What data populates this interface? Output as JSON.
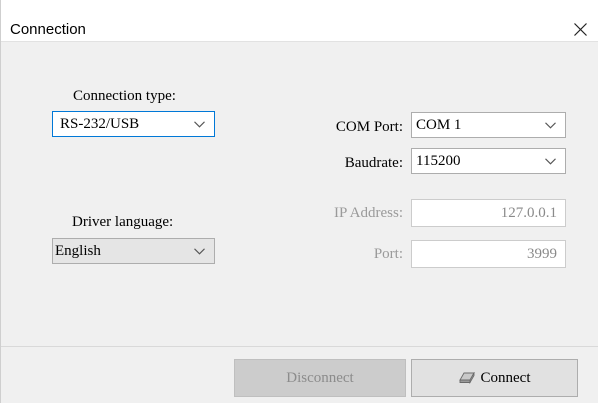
{
  "window": {
    "title": "Connection"
  },
  "connection_type": {
    "label": "Connection type:",
    "selected": "RS-232/USB"
  },
  "driver_language": {
    "label": "Driver language:",
    "selected": "English"
  },
  "com_port": {
    "label": "COM Port:",
    "selected": "COM 1"
  },
  "baudrate": {
    "label": "Baudrate:",
    "selected": "115200"
  },
  "ip_address": {
    "label": "IP Address:",
    "value": "127.0.0.1"
  },
  "port": {
    "label": "Port:",
    "value": "3999"
  },
  "buttons": {
    "disconnect": "Disconnect",
    "connect": "Connect"
  },
  "icons": {
    "close": "close-icon",
    "chevron": "chevron-down-icon",
    "connect": "eraser-icon"
  },
  "colors": {
    "focus_border": "#0078d7",
    "disabled_text": "#9a9a9a"
  }
}
